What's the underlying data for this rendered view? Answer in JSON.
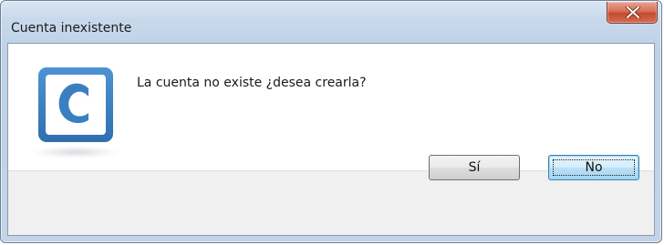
{
  "window": {
    "title": "Cuenta inexistente"
  },
  "titlebar": {
    "close_icon": "close-icon",
    "close_color": "#c44a30"
  },
  "dialog": {
    "icon": "app-logo-c-icon",
    "icon_color": "#3a7fc1",
    "message": "La cuenta no existe ¿desea crearla?"
  },
  "buttons": {
    "yes_label": "Sí",
    "no_label": "No"
  }
}
